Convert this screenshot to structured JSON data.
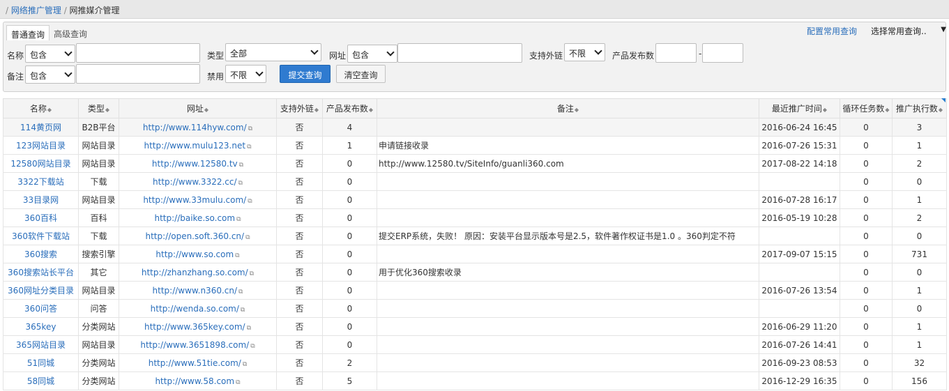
{
  "breadcrumb": {
    "items": [
      "网络推广管理",
      "网推媒介管理"
    ]
  },
  "query": {
    "tabs": [
      {
        "label": "普通查询",
        "active": true
      },
      {
        "label": "高级查询",
        "active": false
      }
    ],
    "config_link": "配置常用查询",
    "common_query_select": "选择常用查询..",
    "fields": {
      "name_label": "名称",
      "name_op": "包含",
      "name_value": "",
      "type_label": "类型",
      "type_value": "全部",
      "url_label": "网址",
      "url_op": "包含",
      "url_value": "",
      "ext_link_label": "支持外链",
      "ext_link_value": "不限",
      "pub_count_label": "产品发布数",
      "pub_from": "",
      "range_sep": "-",
      "pub_to": "",
      "remark_label": "备注",
      "remark_op": "包含",
      "remark_value": "",
      "disabled_label": "禁用",
      "disabled_value": "不限"
    },
    "submit_label": "提交查询",
    "clear_label": "清空查询"
  },
  "table": {
    "columns": [
      "名称",
      "类型",
      "网址",
      "支持外链",
      "产品发布数",
      "备注",
      "最近推广时间",
      "循环任务数",
      "推广执行数"
    ],
    "rows": [
      [
        "114黄页网",
        "B2B平台",
        "http://www.114hyw.com/",
        "否",
        "4",
        "",
        "2016-06-24 16:45",
        "0",
        "3"
      ],
      [
        "123网站目录",
        "网站目录",
        "http://www.mulu123.net",
        "否",
        "1",
        "申请链接收录",
        "2016-07-26 15:31",
        "0",
        "1"
      ],
      [
        "12580网站目录",
        "网站目录",
        "http://www.12580.tv",
        "否",
        "0",
        "http://www.12580.tv/SiteInfo/guanli360.com",
        "2017-08-22 14:18",
        "0",
        "2"
      ],
      [
        "3322下载站",
        "下载",
        "http://www.3322.cc/",
        "否",
        "0",
        "",
        "",
        "0",
        "0"
      ],
      [
        "33目录网",
        "网站目录",
        "http://www.33mulu.com/",
        "否",
        "0",
        "",
        "2016-07-28 16:17",
        "0",
        "1"
      ],
      [
        "360百科",
        "百科",
        "http://baike.so.com",
        "否",
        "0",
        "",
        "2016-05-19 10:28",
        "0",
        "2"
      ],
      [
        "360软件下载站",
        "下载",
        "http://open.soft.360.cn/",
        "否",
        "0",
        "提交ERP系统，失败！ 原因：安装平台显示版本号是2.5，软件著作权证书是1.0 。360判定不符",
        "",
        "0",
        "0"
      ],
      [
        "360搜索",
        "搜索引擎",
        "http://www.so.com",
        "否",
        "0",
        "",
        "2017-09-07 15:15",
        "0",
        "731"
      ],
      [
        "360搜索站长平台",
        "其它",
        "http://zhanzhang.so.com/",
        "否",
        "0",
        "用于优化360搜索收录",
        "",
        "0",
        "0"
      ],
      [
        "360网址分类目录",
        "网站目录",
        "http://www.n360.cn/",
        "否",
        "0",
        "",
        "2016-07-26 13:54",
        "0",
        "1"
      ],
      [
        "360问答",
        "问答",
        "http://wenda.so.com/",
        "否",
        "0",
        "",
        "",
        "0",
        "0"
      ],
      [
        "365key",
        "分类网站",
        "http://www.365key.com/",
        "否",
        "0",
        "",
        "2016-06-29 11:20",
        "0",
        "1"
      ],
      [
        "365网站目录",
        "网站目录",
        "http://www.3651898.com/",
        "否",
        "0",
        "",
        "2016-07-26 14:41",
        "0",
        "1"
      ],
      [
        "51同城",
        "分类网站",
        "http://www.51tie.com/",
        "否",
        "2",
        "",
        "2016-09-23 08:53",
        "0",
        "32"
      ],
      [
        "58同城",
        "分类网站",
        "http://www.58.com",
        "否",
        "5",
        "",
        "2016-12-29 16:35",
        "0",
        "156"
      ]
    ]
  }
}
